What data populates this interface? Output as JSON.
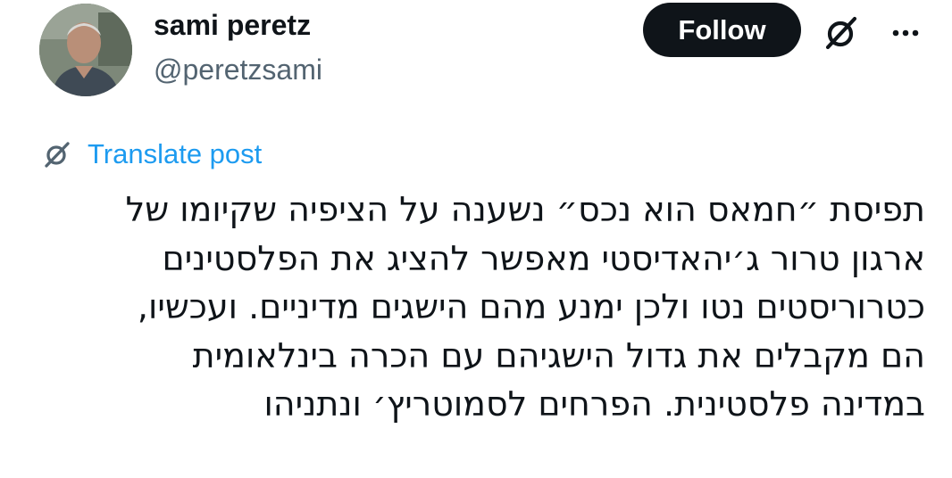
{
  "author": {
    "display_name": "sami peretz",
    "handle": "@peretzsami",
    "avatar_icon": "profile-photo"
  },
  "actions": {
    "follow_label": "Follow",
    "grok_icon": "grok-icon",
    "more_icon": "more-horizontal-icon"
  },
  "translate": {
    "label": "Translate post",
    "icon": "grok-icon"
  },
  "post": {
    "lines": [
      "תפיסת ״חמאס הוא נכס״ נשענה על הציפיה שקיומו של",
      "ארגון  טרור ג׳יהאדיסטי מאפשר להציג את הפלסטינים",
      "כטרוריסטים נטו ולכן ימנע מהם הישגים מדיניים. ועכשיו,",
      "הם מקבלים את גדול הישגיהם עם הכרה בינלאומית",
      "במדינה פלסטינית. הפרחים לסמוטריץ׳ ונתניהו"
    ]
  },
  "colors": {
    "text_primary": "#0f1419",
    "text_secondary": "#536471",
    "link": "#1d9bf0",
    "button_bg": "#0f1419",
    "button_text": "#ffffff"
  }
}
